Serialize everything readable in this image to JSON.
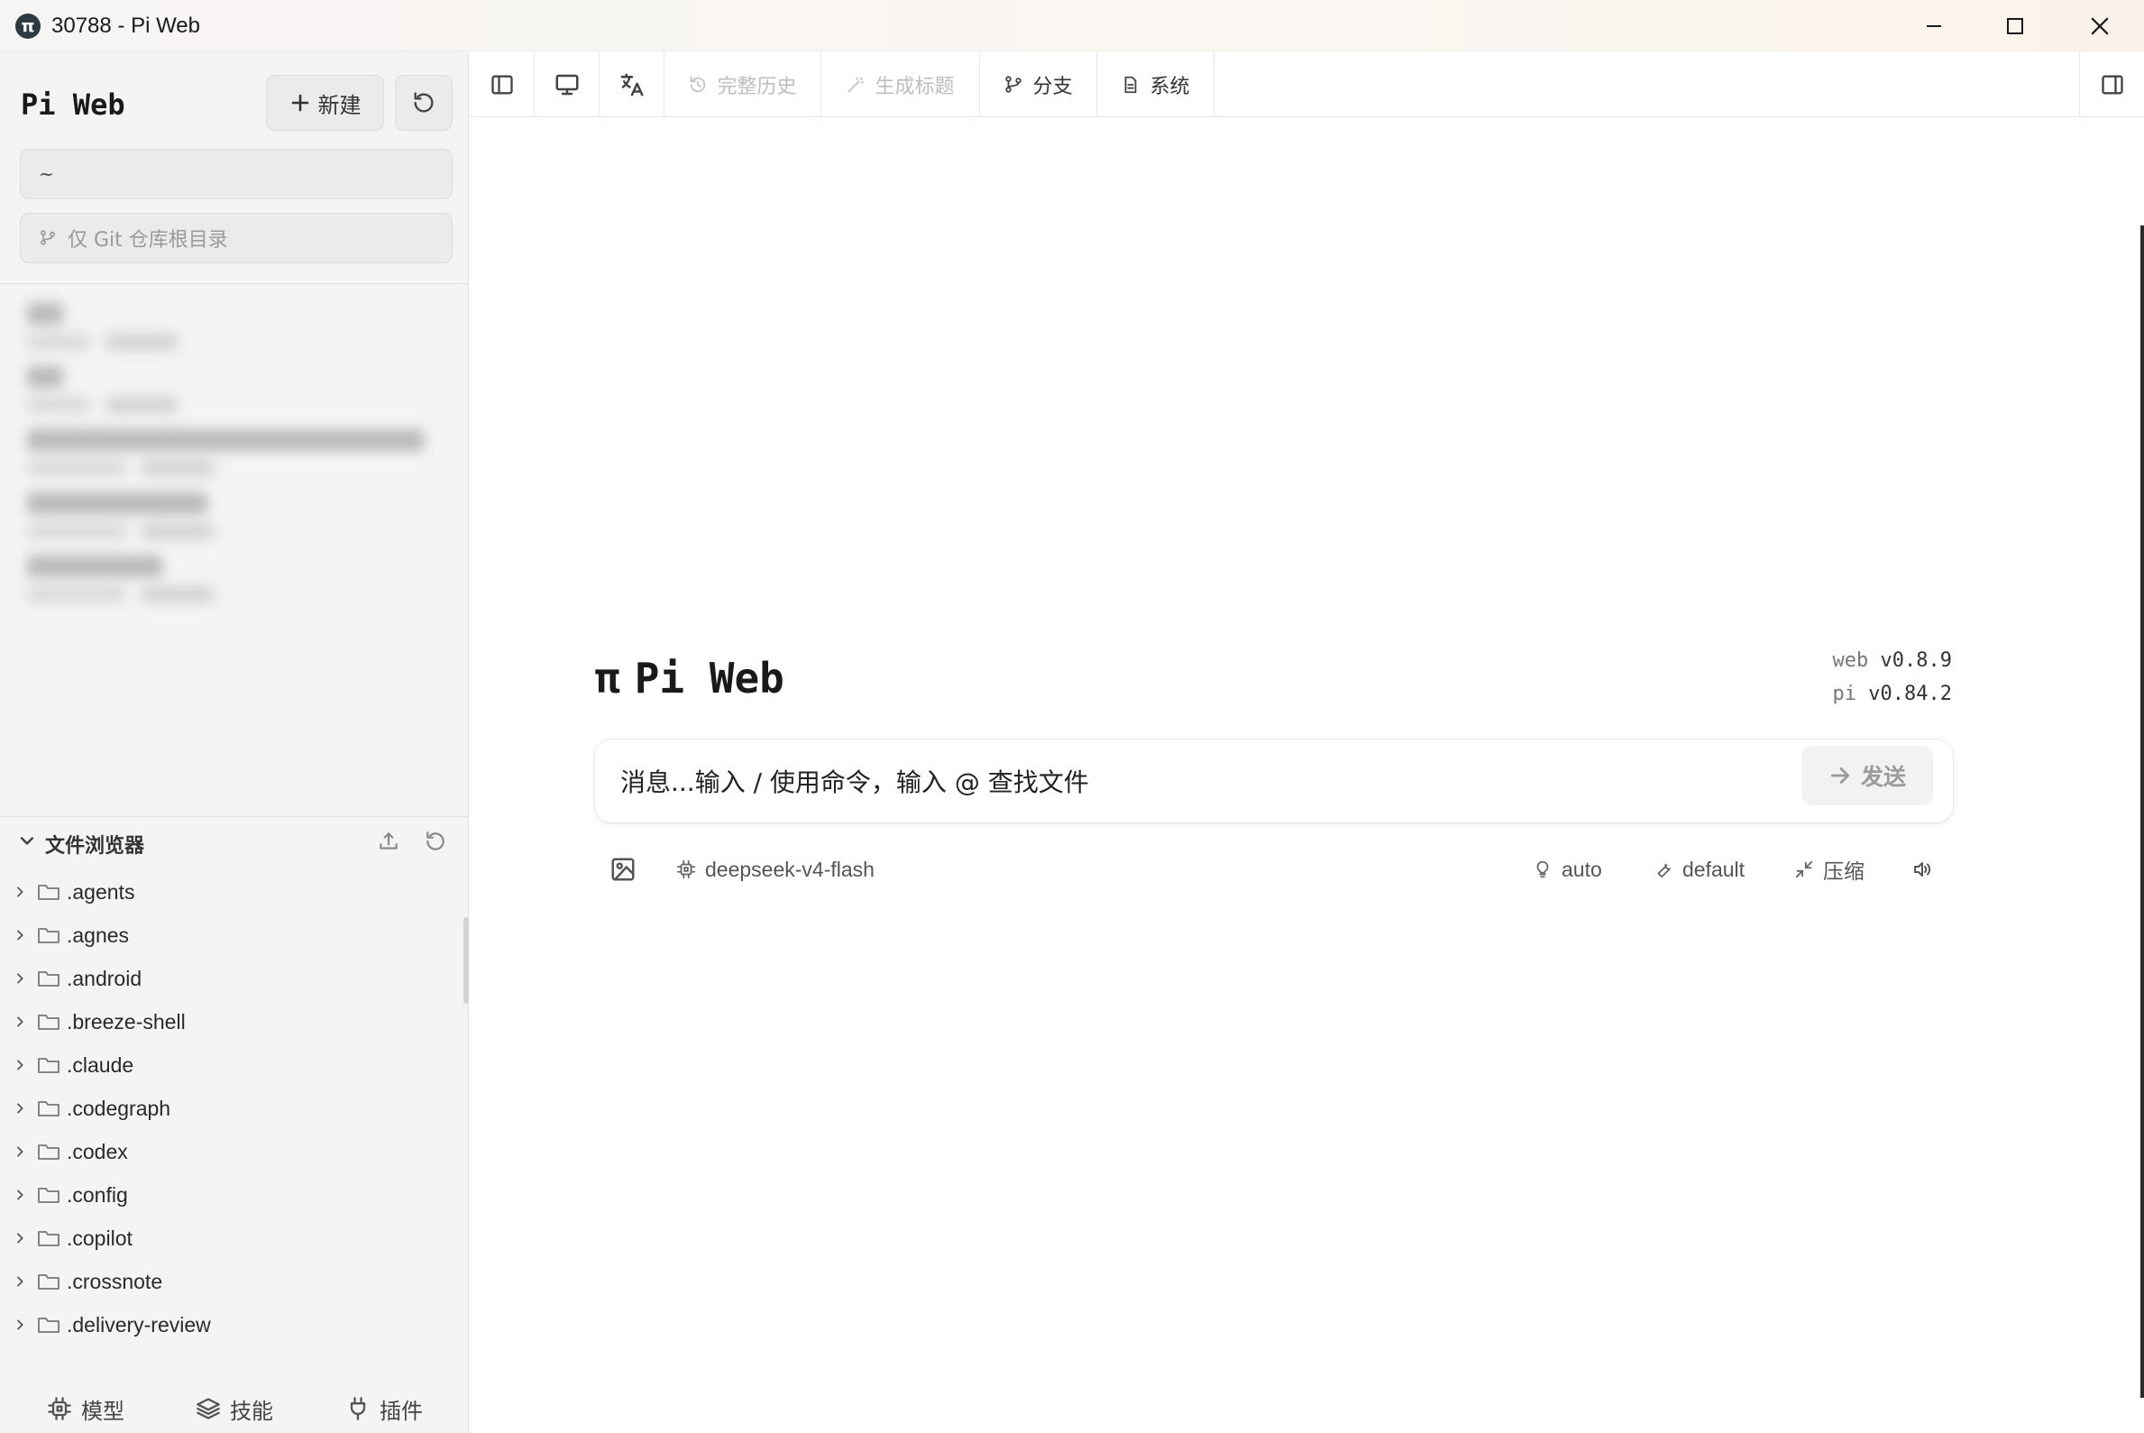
{
  "window": {
    "logo": "π",
    "title": "30788 - Pi Web"
  },
  "sidebar": {
    "title": "Pi Web",
    "new_label": "新建",
    "path_value": "~",
    "git_placeholder": "仅 Git 仓库根目录",
    "file_browser_title": "文件浏览器",
    "files": [
      ".agents",
      ".agnes",
      ".android",
      ".breeze-shell",
      ".claude",
      ".codegraph",
      ".codex",
      ".config",
      ".copilot",
      ".crossnote",
      ".delivery-review"
    ],
    "bottom_tabs": {
      "models": "模型",
      "skills": "技能",
      "plugins": "插件"
    }
  },
  "toolbar": {
    "full_history": "完整历史",
    "gen_title": "生成标题",
    "branch": "分支",
    "system": "系统"
  },
  "main": {
    "brand_symbol": "π",
    "brand_name": "Pi Web",
    "web_key": "web",
    "web_version": "v0.8.9",
    "pi_key": "pi",
    "pi_version": "v0.84.2",
    "chat_placeholder": "消息...输入 / 使用命令，输入 @ 查找文件",
    "send_label": "发送",
    "model_name": "deepseek-v4-flash",
    "thinking_mode": "auto",
    "permission_mode": "default",
    "compress_label": "压缩"
  }
}
